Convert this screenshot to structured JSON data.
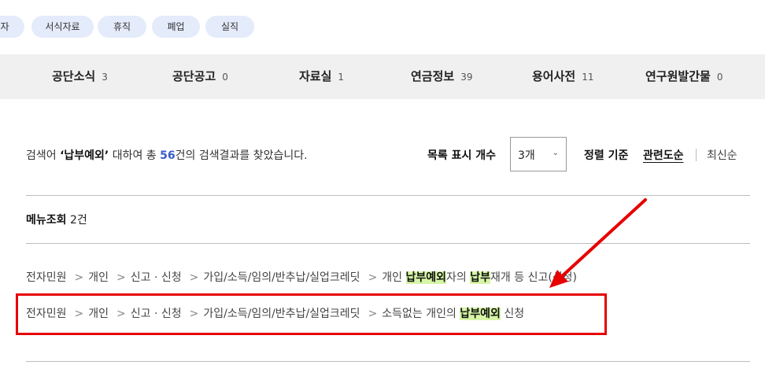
{
  "filter_chips": [
    "입자",
    "서식자료",
    "휴직",
    "폐업",
    "실직"
  ],
  "categories": [
    {
      "label": "공단소식",
      "count": "3"
    },
    {
      "label": "공단공고",
      "count": "0"
    },
    {
      "label": "자료실",
      "count": "1"
    },
    {
      "label": "연금정보",
      "count": "39"
    },
    {
      "label": "용어사전",
      "count": "11"
    },
    {
      "label": "연구원발간물",
      "count": "0"
    }
  ],
  "summary": {
    "prefix": "검색어 ",
    "query": "‘납부예외’",
    "middle": " 대하여 총 ",
    "count": "56",
    "suffix": "건의 검색결과를 찾았습니다."
  },
  "list_count": {
    "label": "목록 표시 개수",
    "value": "3개"
  },
  "sort": {
    "label": "정렬 기준",
    "options": [
      "관련도순",
      "최신순"
    ],
    "active": "관련도순"
  },
  "menu_section": {
    "title": "메뉴조회",
    "count": "2건"
  },
  "menu_results": [
    {
      "path": [
        "전자민원",
        "개인",
        "신고 · 신청",
        "가입/소득/임의/반추납/실업크레딧"
      ],
      "title_parts": [
        {
          "text": "개인 ",
          "hl": false
        },
        {
          "text": "납부예외",
          "hl": true
        },
        {
          "text": "자의 ",
          "hl": false
        },
        {
          "text": "납부",
          "hl": true
        },
        {
          "text": "재개 등 신고(신청)",
          "hl": false
        }
      ]
    },
    {
      "path": [
        "전자민원",
        "개인",
        "신고 · 신청",
        "가입/소득/임의/반추납/실업크레딧"
      ],
      "title_parts": [
        {
          "text": "소득없는 개인의 ",
          "hl": false
        },
        {
          "text": "납부예외",
          "hl": true
        },
        {
          "text": " 신청",
          "hl": false
        }
      ]
    }
  ],
  "annotation_color": "#e60000",
  "highlight_color": "#d6f5a6",
  "accent_color": "#3b5bc8"
}
